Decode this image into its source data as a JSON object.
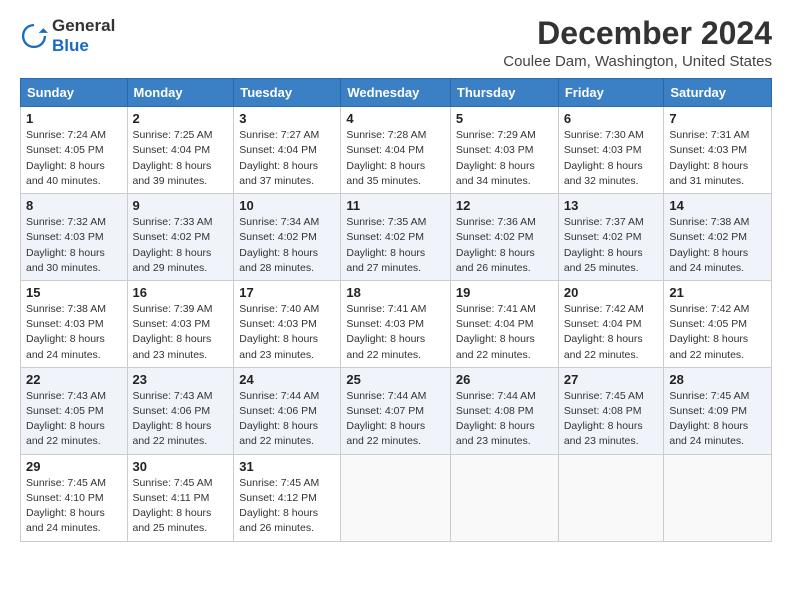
{
  "logo": {
    "line1": "General",
    "line2": "Blue"
  },
  "title": "December 2024",
  "location": "Coulee Dam, Washington, United States",
  "days_of_week": [
    "Sunday",
    "Monday",
    "Tuesday",
    "Wednesday",
    "Thursday",
    "Friday",
    "Saturday"
  ],
  "weeks": [
    [
      {
        "day": "1",
        "info": "Sunrise: 7:24 AM\nSunset: 4:05 PM\nDaylight: 8 hours\nand 40 minutes."
      },
      {
        "day": "2",
        "info": "Sunrise: 7:25 AM\nSunset: 4:04 PM\nDaylight: 8 hours\nand 39 minutes."
      },
      {
        "day": "3",
        "info": "Sunrise: 7:27 AM\nSunset: 4:04 PM\nDaylight: 8 hours\nand 37 minutes."
      },
      {
        "day": "4",
        "info": "Sunrise: 7:28 AM\nSunset: 4:04 PM\nDaylight: 8 hours\nand 35 minutes."
      },
      {
        "day": "5",
        "info": "Sunrise: 7:29 AM\nSunset: 4:03 PM\nDaylight: 8 hours\nand 34 minutes."
      },
      {
        "day": "6",
        "info": "Sunrise: 7:30 AM\nSunset: 4:03 PM\nDaylight: 8 hours\nand 32 minutes."
      },
      {
        "day": "7",
        "info": "Sunrise: 7:31 AM\nSunset: 4:03 PM\nDaylight: 8 hours\nand 31 minutes."
      }
    ],
    [
      {
        "day": "8",
        "info": "Sunrise: 7:32 AM\nSunset: 4:03 PM\nDaylight: 8 hours\nand 30 minutes."
      },
      {
        "day": "9",
        "info": "Sunrise: 7:33 AM\nSunset: 4:02 PM\nDaylight: 8 hours\nand 29 minutes."
      },
      {
        "day": "10",
        "info": "Sunrise: 7:34 AM\nSunset: 4:02 PM\nDaylight: 8 hours\nand 28 minutes."
      },
      {
        "day": "11",
        "info": "Sunrise: 7:35 AM\nSunset: 4:02 PM\nDaylight: 8 hours\nand 27 minutes."
      },
      {
        "day": "12",
        "info": "Sunrise: 7:36 AM\nSunset: 4:02 PM\nDaylight: 8 hours\nand 26 minutes."
      },
      {
        "day": "13",
        "info": "Sunrise: 7:37 AM\nSunset: 4:02 PM\nDaylight: 8 hours\nand 25 minutes."
      },
      {
        "day": "14",
        "info": "Sunrise: 7:38 AM\nSunset: 4:02 PM\nDaylight: 8 hours\nand 24 minutes."
      }
    ],
    [
      {
        "day": "15",
        "info": "Sunrise: 7:38 AM\nSunset: 4:03 PM\nDaylight: 8 hours\nand 24 minutes."
      },
      {
        "day": "16",
        "info": "Sunrise: 7:39 AM\nSunset: 4:03 PM\nDaylight: 8 hours\nand 23 minutes."
      },
      {
        "day": "17",
        "info": "Sunrise: 7:40 AM\nSunset: 4:03 PM\nDaylight: 8 hours\nand 23 minutes."
      },
      {
        "day": "18",
        "info": "Sunrise: 7:41 AM\nSunset: 4:03 PM\nDaylight: 8 hours\nand 22 minutes."
      },
      {
        "day": "19",
        "info": "Sunrise: 7:41 AM\nSunset: 4:04 PM\nDaylight: 8 hours\nand 22 minutes."
      },
      {
        "day": "20",
        "info": "Sunrise: 7:42 AM\nSunset: 4:04 PM\nDaylight: 8 hours\nand 22 minutes."
      },
      {
        "day": "21",
        "info": "Sunrise: 7:42 AM\nSunset: 4:05 PM\nDaylight: 8 hours\nand 22 minutes."
      }
    ],
    [
      {
        "day": "22",
        "info": "Sunrise: 7:43 AM\nSunset: 4:05 PM\nDaylight: 8 hours\nand 22 minutes."
      },
      {
        "day": "23",
        "info": "Sunrise: 7:43 AM\nSunset: 4:06 PM\nDaylight: 8 hours\nand 22 minutes."
      },
      {
        "day": "24",
        "info": "Sunrise: 7:44 AM\nSunset: 4:06 PM\nDaylight: 8 hours\nand 22 minutes."
      },
      {
        "day": "25",
        "info": "Sunrise: 7:44 AM\nSunset: 4:07 PM\nDaylight: 8 hours\nand 22 minutes."
      },
      {
        "day": "26",
        "info": "Sunrise: 7:44 AM\nSunset: 4:08 PM\nDaylight: 8 hours\nand 23 minutes."
      },
      {
        "day": "27",
        "info": "Sunrise: 7:45 AM\nSunset: 4:08 PM\nDaylight: 8 hours\nand 23 minutes."
      },
      {
        "day": "28",
        "info": "Sunrise: 7:45 AM\nSunset: 4:09 PM\nDaylight: 8 hours\nand 24 minutes."
      }
    ],
    [
      {
        "day": "29",
        "info": "Sunrise: 7:45 AM\nSunset: 4:10 PM\nDaylight: 8 hours\nand 24 minutes."
      },
      {
        "day": "30",
        "info": "Sunrise: 7:45 AM\nSunset: 4:11 PM\nDaylight: 8 hours\nand 25 minutes."
      },
      {
        "day": "31",
        "info": "Sunrise: 7:45 AM\nSunset: 4:12 PM\nDaylight: 8 hours\nand 26 minutes."
      },
      null,
      null,
      null,
      null
    ]
  ]
}
